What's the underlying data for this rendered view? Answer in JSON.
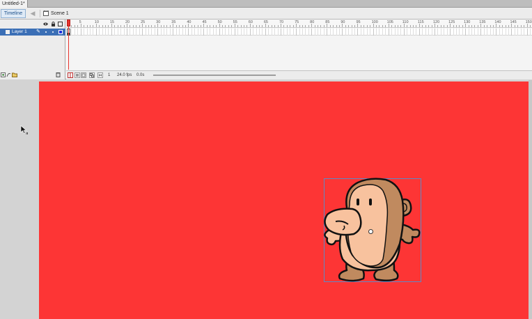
{
  "document": {
    "tab_title": "Untitled-1*"
  },
  "edit_bar": {
    "timeline_label": "Timeline",
    "scene_label": "Scene 1"
  },
  "timeline": {
    "layer_name": "Layer 1",
    "frame_labels": [
      "5",
      "10",
      "15",
      "20",
      "25",
      "30",
      "35",
      "40",
      "45",
      "50",
      "55",
      "60",
      "65",
      "70",
      "75",
      "80",
      "85",
      "90",
      "95",
      "100",
      "105",
      "110",
      "115",
      "120",
      "125",
      "130",
      "135",
      "140",
      "145",
      "150"
    ],
    "current_frame": "1",
    "frame_rate": "24.0 fps",
    "elapsed_time": "0.0s"
  },
  "stage": {
    "background_color": "#fd3535"
  },
  "icons": {
    "header": [
      "eye-icon",
      "lock-icon",
      "outline-icon"
    ],
    "layer_tools": [
      "new-layer-icon",
      "motion-guide-icon",
      "new-folder-icon",
      "delete-layer-icon"
    ],
    "timeline_tools": [
      "center-frame-icon",
      "onion-skin-icon",
      "onion-outline-icon",
      "edit-multiple-frames-icon",
      "onion-markers-icon"
    ]
  }
}
